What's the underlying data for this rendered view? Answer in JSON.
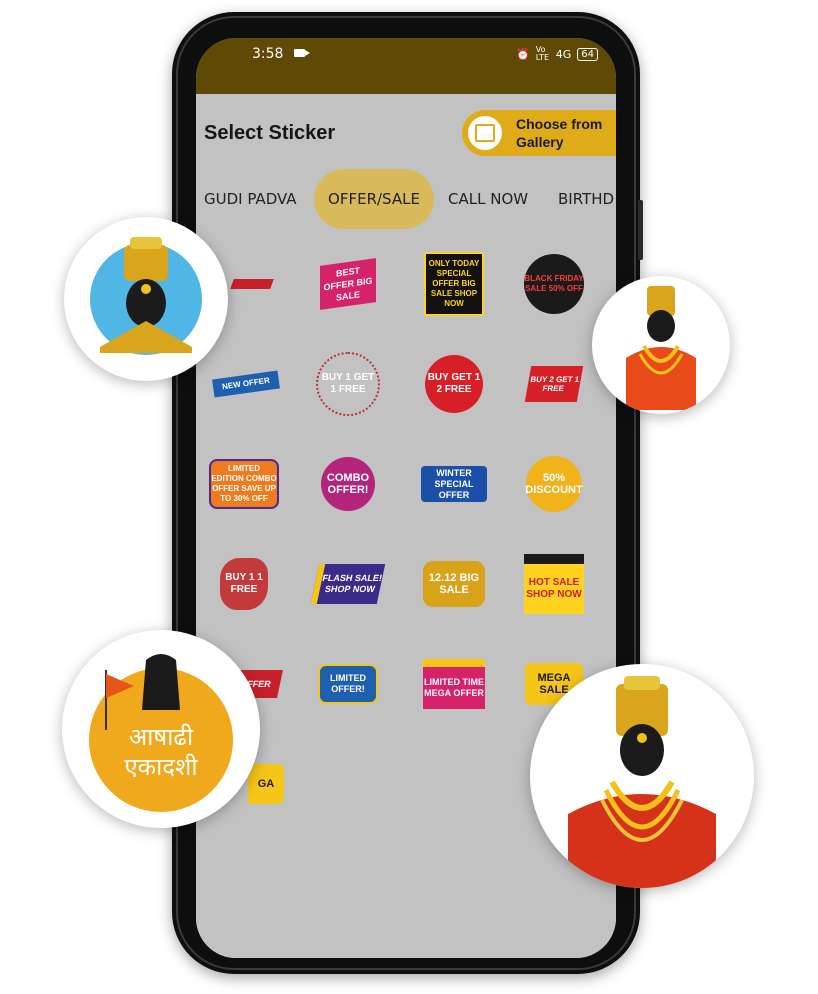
{
  "status_bar": {
    "time": "3:58",
    "network": "Vo LTE",
    "signal": "4G",
    "battery": "64"
  },
  "header": {
    "title": "Select Sticker",
    "gallery_button": "Choose from Gallery"
  },
  "tabs": [
    {
      "label": "GUDI PADVA",
      "active": false
    },
    {
      "label": "OFFER/SALE",
      "active": true
    },
    {
      "label": "CALL NOW",
      "active": false
    },
    {
      "label": "BIRTHD",
      "active": false
    }
  ],
  "stickers": [
    {
      "text": "",
      "icon": "red-ribbon-sticker"
    },
    {
      "text": "BEST OFFER BIG SALE",
      "icon": "big-sale-sticker"
    },
    {
      "text": "ONLY TODAY SPECIAL OFFER BIG SALE SHOP NOW",
      "icon": "big-sale-badge-sticker"
    },
    {
      "text": "BLACK FRIDAY SALE 50% OFF",
      "icon": "black-friday-sticker"
    },
    {
      "text": "NEW OFFER",
      "icon": "new-offer-ribbon-sticker"
    },
    {
      "text": "BUY 1 GET 1 FREE",
      "icon": "buy1get1-outline-sticker"
    },
    {
      "text": "BUY GET 1 2 FREE",
      "icon": "buy1get2-sticker"
    },
    {
      "text": "BUY 2 GET 1 FREE",
      "icon": "buy2get1-sticker"
    },
    {
      "text": "LIMITED EDITION COMBO OFFER SAVE UP TO 30% OFF",
      "icon": "combo-offer-sticker"
    },
    {
      "text": "COMBO OFFER!",
      "icon": "combo-offer-circle-sticker"
    },
    {
      "text": "WINTER SPECIAL OFFER",
      "icon": "winter-offer-sticker"
    },
    {
      "text": "50% DISCOUNT",
      "icon": "discount-sticker"
    },
    {
      "text": "BUY 1 1 FREE",
      "icon": "buy1-free-sticker"
    },
    {
      "text": "FLASH SALE! SHOP NOW",
      "icon": "flash-sale-sticker"
    },
    {
      "text": "12.12 BIG SALE",
      "icon": "twelve-twelve-sticker"
    },
    {
      "text": "HOT SALE SHOP NOW",
      "icon": "hot-sale-sticker"
    },
    {
      "text": "FFER",
      "icon": "last-minute-offer-sticker"
    },
    {
      "text": "LIMITED OFFER!",
      "icon": "limited-offer-sticker"
    },
    {
      "text": "LIMITED TIME MEGA OFFER",
      "icon": "mega-offer-sticker"
    },
    {
      "text": "MEGA SALE",
      "icon": "mega-sale-sticker"
    },
    {
      "text": "GA",
      "icon": "mega-partial-sticker"
    }
  ],
  "bubbles": [
    {
      "name": "vitthal-portrait-bubble-top-left"
    },
    {
      "name": "vitthal-portrait-bubble-top-right"
    },
    {
      "name": "ashadhi-ekadashi-bubble"
    },
    {
      "name": "vitthal-portrait-bubble-bottom-right"
    }
  ],
  "bubble_caption": "आषाढी एकादशी",
  "colors": {
    "accent": "#e0ab19",
    "tab_active": "#d8ba5b",
    "status_bar": "#5e4a04",
    "sheet": "#c2c2c2"
  }
}
